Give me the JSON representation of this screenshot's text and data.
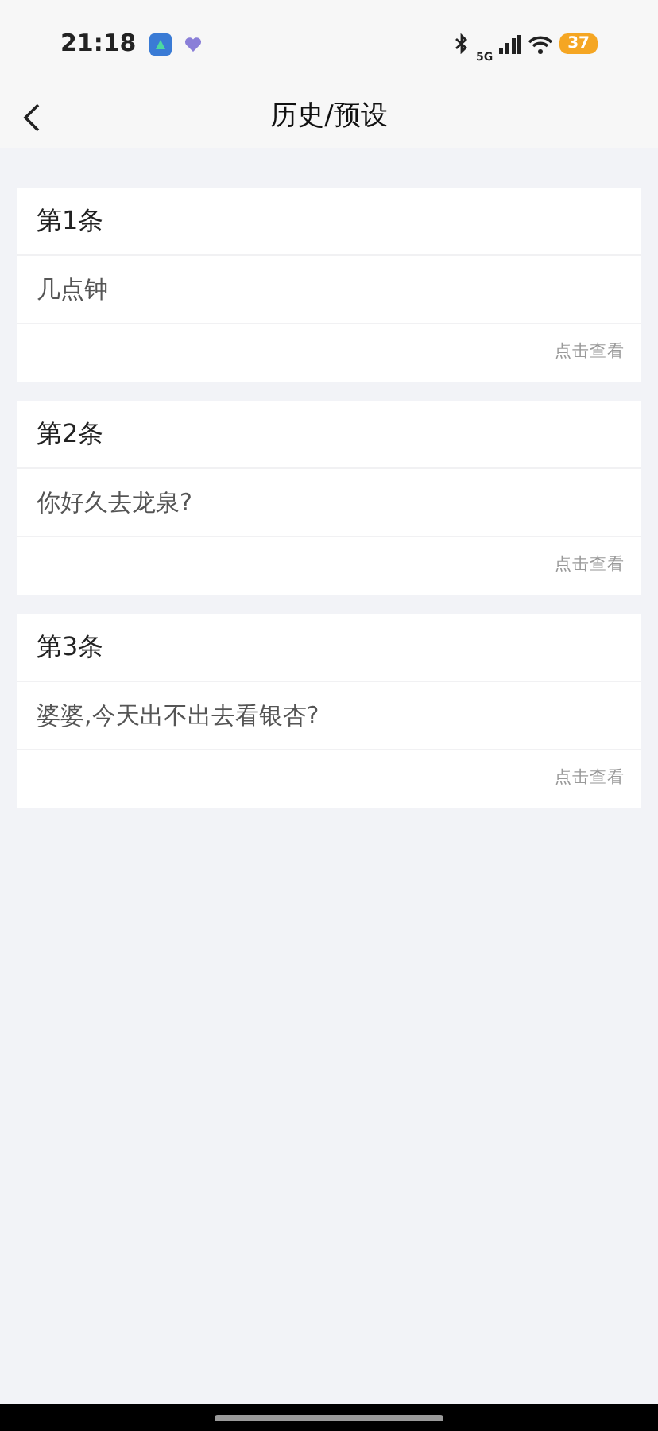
{
  "status_bar": {
    "time": "21:18",
    "network": "5G",
    "battery": "37"
  },
  "header": {
    "title": "历史/预设"
  },
  "entries": [
    {
      "title": "第1条",
      "text": "几点钟",
      "action": "点击查看"
    },
    {
      "title": "第2条",
      "text": "你好久去龙泉?",
      "action": "点击查看"
    },
    {
      "title": "第3条",
      "text": "婆婆,今天出不出去看银杏?",
      "action": "点击查看"
    }
  ]
}
